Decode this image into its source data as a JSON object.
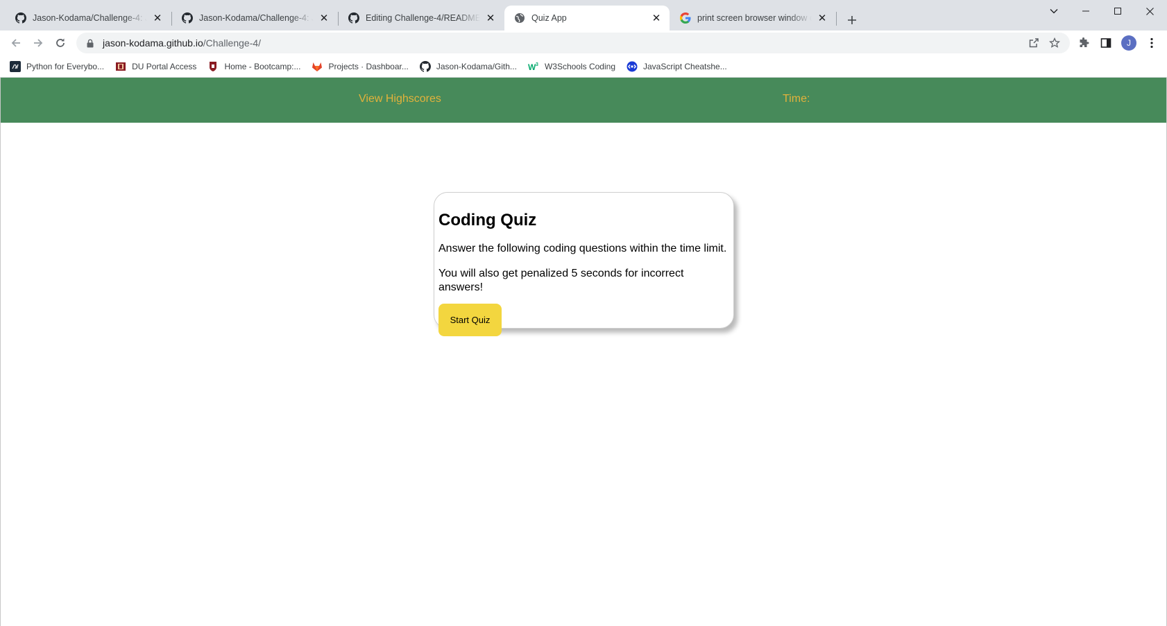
{
  "tabs": [
    {
      "title": "Jason-Kodama/Challenge-4: JavaScript",
      "icon": "github-icon",
      "active": false
    },
    {
      "title": "Jason-Kodama/Challenge-4: JavaScript",
      "icon": "github-icon",
      "active": false
    },
    {
      "title": "Editing Challenge-4/README.md",
      "icon": "github-icon",
      "active": false
    },
    {
      "title": "Quiz App",
      "icon": "globe-icon",
      "active": true
    },
    {
      "title": "print screen browser window chrome",
      "icon": "google-icon",
      "active": false
    }
  ],
  "address_bar": {
    "host": "jason-kodama.github.io",
    "path": "/Challenge-4/"
  },
  "profile": {
    "initial": "J",
    "color": "#5b6fc2"
  },
  "bookmarks": [
    {
      "label": "Python for Everybo...",
      "icon": "py4e-icon"
    },
    {
      "label": "DU Portal Access",
      "icon": "du-icon"
    },
    {
      "label": "Home - Bootcamp:...",
      "icon": "bootcamp-icon"
    },
    {
      "label": "Projects · Dashboar...",
      "icon": "gitlab-icon"
    },
    {
      "label": "Jason-Kodama/Gith...",
      "icon": "github-icon"
    },
    {
      "label": "W3Schools Coding",
      "icon": "w3schools-icon"
    },
    {
      "label": "JavaScript Cheatshe...",
      "icon": "cheatsheet-icon"
    }
  ],
  "page": {
    "header": {
      "highscores_link": "View Highscores",
      "time_label": "Time:"
    },
    "quiz": {
      "title": "Coding Quiz",
      "instructions_1": "Answer the following coding questions within the time limit.",
      "instructions_2": "You will also get penalized 5 seconds for incorrect answers!",
      "start_button": "Start Quiz"
    }
  },
  "colors": {
    "header_bg": "#478a5a",
    "header_text": "#e3b23b",
    "start_button_bg": "#f3d63f"
  }
}
